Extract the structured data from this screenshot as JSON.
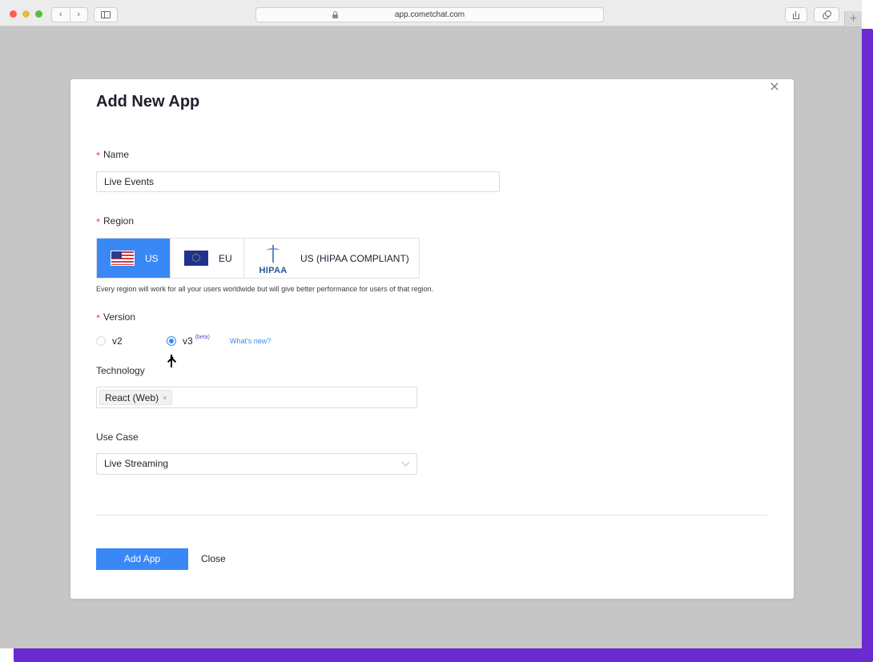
{
  "browser": {
    "url": "app.cometchat.com",
    "new_tab_label": "+"
  },
  "modal": {
    "title": "Add New App",
    "close_label": "×",
    "name_field": {
      "required_mark": "*",
      "label": "Name",
      "value": "Live Events"
    },
    "region_field": {
      "required_mark": "*",
      "label": "Region",
      "options": [
        {
          "label": "US",
          "selected": true
        },
        {
          "label": "EU",
          "selected": false
        },
        {
          "label": "US (HIPAA COMPLIANT)",
          "logo_text": "HIPAA",
          "selected": false
        }
      ],
      "help_text": "Every region will work for all your users worldwide but will give better performance for users of that region."
    },
    "version_field": {
      "required_mark": "*",
      "label": "Version",
      "options": [
        {
          "label": "v2",
          "checked": false
        },
        {
          "label": "v3",
          "badge": "(beta)",
          "checked": true
        }
      ],
      "whats_new": "What's new?"
    },
    "technology_field": {
      "label": "Technology",
      "tags": [
        {
          "label": "React (Web)",
          "remove": "×"
        }
      ]
    },
    "use_case_field": {
      "label": "Use Case",
      "selected": "Live Streaming"
    },
    "actions": {
      "primary": "Add App",
      "secondary": "Close"
    }
  },
  "colors": {
    "accent": "#3a88f5",
    "required": "#f5222d",
    "frame": "#6a2bd0",
    "backdrop": "#c6c6c6"
  }
}
